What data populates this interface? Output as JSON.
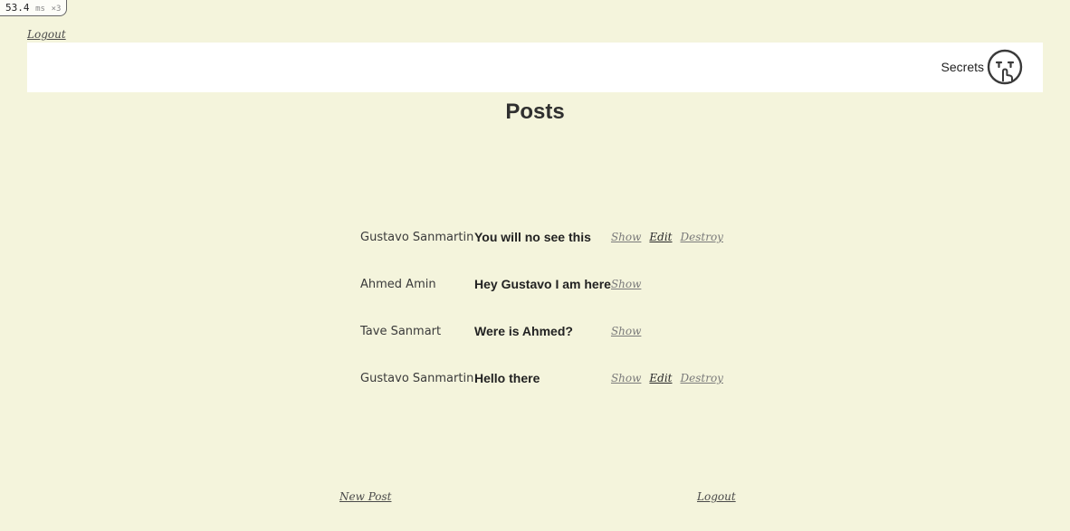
{
  "perf": {
    "value": "53.4",
    "unit": "ms",
    "count": "×3"
  },
  "nav": {
    "logout_label": "Logout"
  },
  "header": {
    "brand_label": "Secrets",
    "brand_icon": "shushing-face-icon"
  },
  "page": {
    "title": "Posts"
  },
  "actions": {
    "show": "Show",
    "edit": "Edit",
    "destroy": "Destroy"
  },
  "posts": [
    {
      "author": "Gustavo Sanmartin",
      "content": "You will no see this",
      "editable": true
    },
    {
      "author": "Ahmed Amin",
      "content": "Hey Gustavo I am here",
      "editable": false
    },
    {
      "author": "Tave Sanmart",
      "content": "Were is Ahmed?",
      "editable": false
    },
    {
      "author": "Gustavo Sanmartin",
      "content": "Hello there",
      "editable": true
    }
  ],
  "footer": {
    "new_post_label": "New Post",
    "logout_label": "Logout"
  },
  "colors": {
    "background": "#f4f4dc",
    "header": "#ffffff",
    "text": "#2f2f2f"
  }
}
